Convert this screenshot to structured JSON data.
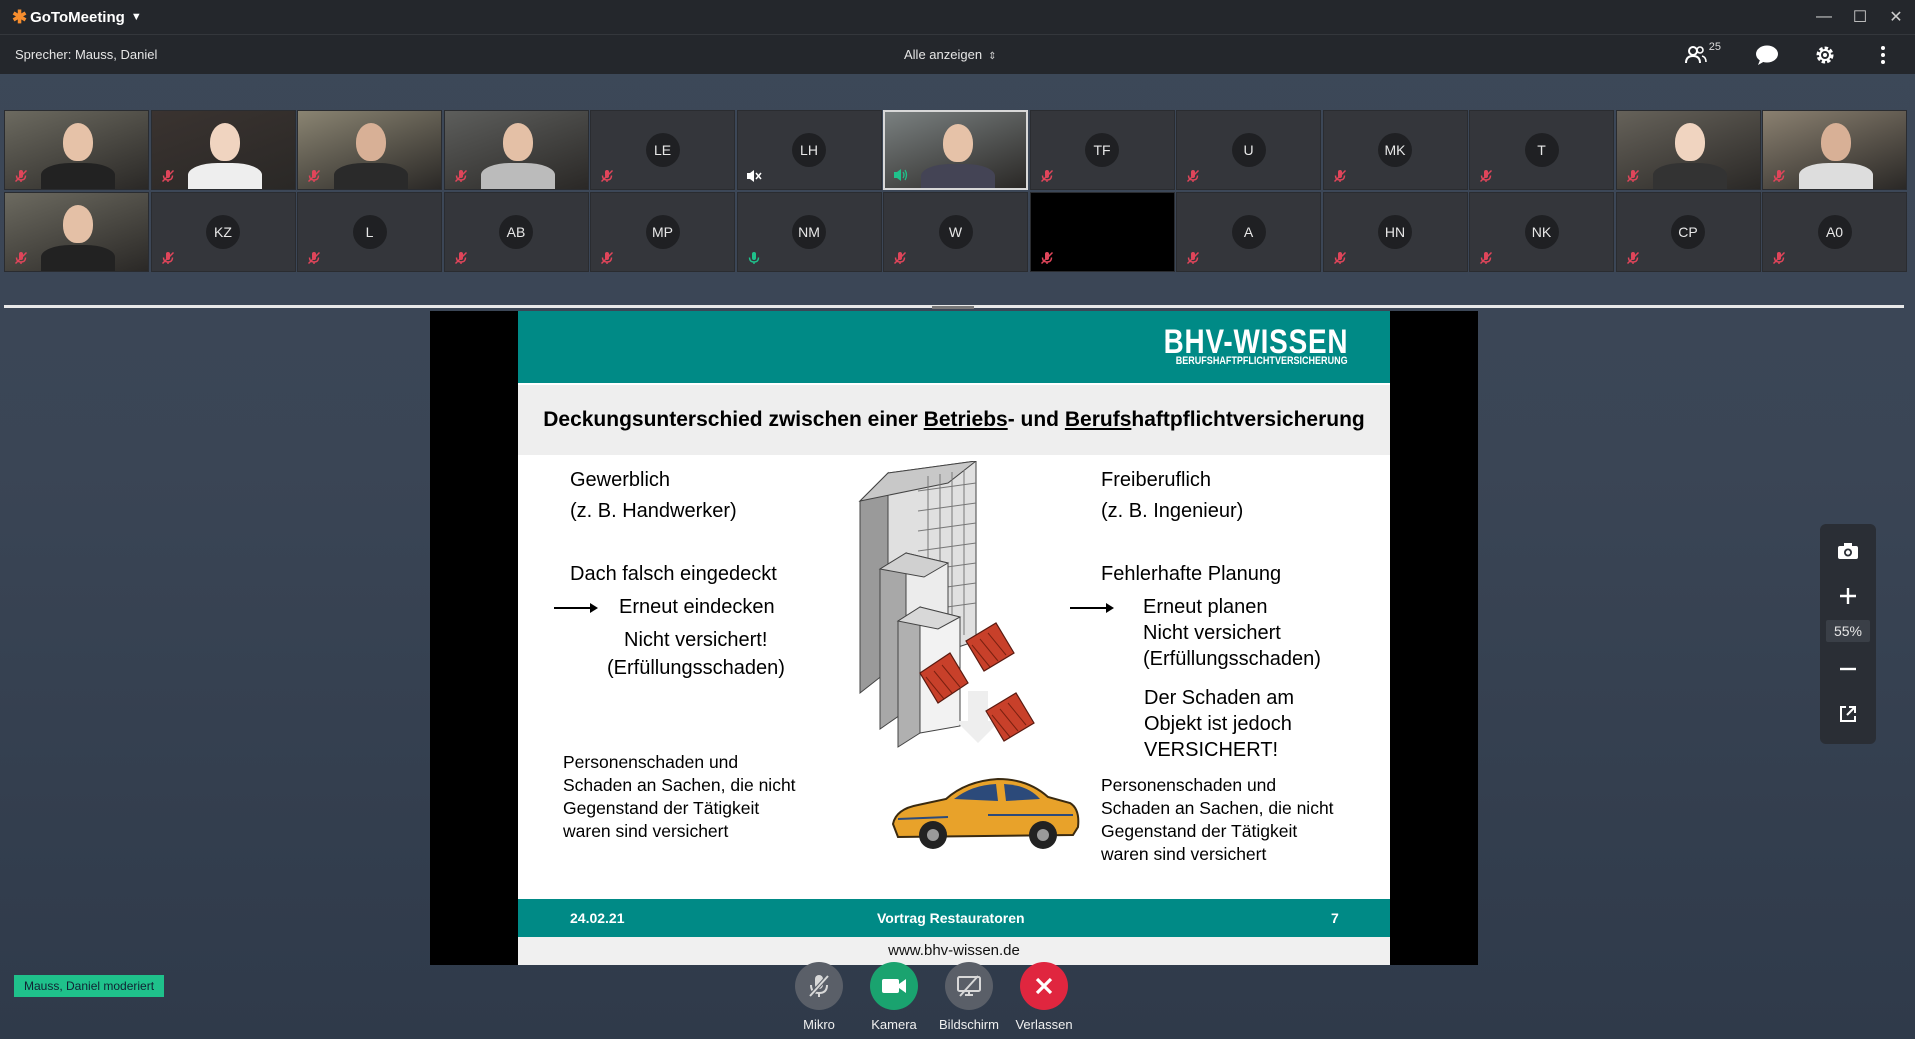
{
  "app": {
    "name": "GoToMeeting"
  },
  "toolbar": {
    "speaker": "Sprecher: Mauss, Daniel",
    "view_mode": "Alle anzeigen",
    "participant_count": "25"
  },
  "participants_row1": [
    {
      "type": "video",
      "mic": "muted"
    },
    {
      "type": "video",
      "mic": "muted"
    },
    {
      "type": "video",
      "mic": "muted"
    },
    {
      "type": "video",
      "mic": "muted"
    },
    {
      "type": "avatar",
      "initials": "LE",
      "mic": "muted"
    },
    {
      "type": "avatar",
      "initials": "LH",
      "mic": "speaker-off"
    },
    {
      "type": "video",
      "mic": "speaking",
      "active": true
    },
    {
      "type": "avatar",
      "initials": "TF",
      "mic": "muted"
    },
    {
      "type": "avatar",
      "initials": "U",
      "mic": "muted"
    },
    {
      "type": "avatar",
      "initials": "MK",
      "mic": "muted"
    },
    {
      "type": "avatar",
      "initials": "T",
      "mic": "muted"
    },
    {
      "type": "video",
      "mic": "muted"
    },
    {
      "type": "video",
      "mic": "muted"
    }
  ],
  "participants_row2": [
    {
      "type": "video",
      "mic": "muted"
    },
    {
      "type": "avatar",
      "initials": "KZ",
      "mic": "muted"
    },
    {
      "type": "avatar",
      "initials": "L",
      "mic": "muted"
    },
    {
      "type": "avatar",
      "initials": "AB",
      "mic": "muted"
    },
    {
      "type": "avatar",
      "initials": "MP",
      "mic": "muted"
    },
    {
      "type": "avatar",
      "initials": "NM",
      "mic": "on"
    },
    {
      "type": "avatar",
      "initials": "W",
      "mic": "muted"
    },
    {
      "type": "black",
      "mic": "muted"
    },
    {
      "type": "avatar",
      "initials": "A",
      "mic": "muted"
    },
    {
      "type": "avatar",
      "initials": "HN",
      "mic": "muted"
    },
    {
      "type": "avatar",
      "initials": "NK",
      "mic": "muted"
    },
    {
      "type": "avatar",
      "initials": "CP",
      "mic": "muted"
    },
    {
      "type": "avatar",
      "initials": "A0",
      "mic": "muted"
    }
  ],
  "slide": {
    "brand": "BHV-WISSEN",
    "brand_sub": "BERUFSHAFTPFLICHTVERSICHERUNG",
    "heading_pre": "Deckungsunterschied zwischen einer ",
    "heading_u1": "Betriebs",
    "heading_mid": "- und ",
    "heading_u2": "Berufs",
    "heading_post": "haftpflichtversicherung",
    "left": {
      "line1": "Gewerblich",
      "line2": "(z. B. Handwerker)",
      "line3": "Dach falsch eingedeckt",
      "line4": "Erneut eindecken",
      "line5": "Nicht versichert!",
      "line6": "(Erfüllungsschaden)",
      "p1": "Personenschaden und",
      "p2": "Schaden an Sachen, die nicht",
      "p3": "Gegenstand der Tätigkeit",
      "p4": "waren sind versichert"
    },
    "right": {
      "line1": "Freiberuflich",
      "line2": "(z. B. Ingenieur)",
      "line3": "Fehlerhafte Planung",
      "line4": "Erneut  planen",
      "line5": "Nicht versichert",
      "line6": "(Erfüllungsschaden)",
      "line7": "Der Schaden am",
      "line8": "Objekt ist jedoch",
      "line9": "VERSICHERT!",
      "p1": "Personenschaden und",
      "p2": "Schaden an Sachen, die nicht",
      "p3": "Gegenstand der Tätigkeit",
      "p4": "waren sind versichert"
    },
    "footer_date": "24.02.21",
    "footer_title": "Vortrag Restauratoren",
    "footer_page": "7",
    "url": "www.bhv-wissen.de"
  },
  "zoom": {
    "level": "55%"
  },
  "moderator_badge": "Mauss, Daniel moderiert",
  "controls": {
    "mic_label": "Mikro",
    "camera_label": "Kamera",
    "screen_label": "Bildschirm",
    "leave_label": "Verlassen"
  },
  "colors": {
    "teal": "#008a86",
    "mute_red": "#e0455a",
    "camera_green": "#1aa36f",
    "leave_red": "#e0263f",
    "moderator_green": "#1fc18b"
  }
}
